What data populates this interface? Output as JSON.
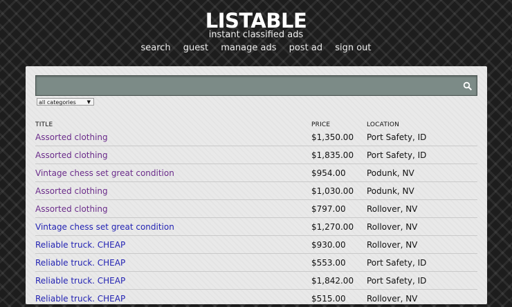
{
  "app": {
    "title": "LISTABLE",
    "tagline": "instant classified ads"
  },
  "nav": [
    {
      "label": "search"
    },
    {
      "label": "guest"
    },
    {
      "label": "manage ads"
    },
    {
      "label": "post ad"
    },
    {
      "label": "sign out"
    }
  ],
  "search": {
    "value": "",
    "category_selected": "all categories"
  },
  "table": {
    "headers": {
      "title": "TITLE",
      "price": "PRICE",
      "location": "LOCATION"
    },
    "rows": [
      {
        "title": "Assorted clothing",
        "price": "$1,350.00",
        "location": "Port Safety, ID",
        "visited": true
      },
      {
        "title": "Assorted clothing",
        "price": "$1,835.00",
        "location": "Port Safety, ID",
        "visited": true
      },
      {
        "title": "Vintage chess set great condition",
        "price": "$954.00",
        "location": "Podunk, NV",
        "visited": true
      },
      {
        "title": "Assorted clothing",
        "price": "$1,030.00",
        "location": "Podunk, NV",
        "visited": true
      },
      {
        "title": "Assorted clothing",
        "price": "$797.00",
        "location": "Rollover, NV",
        "visited": true
      },
      {
        "title": "Vintage chess set great condition",
        "price": "$1,270.00",
        "location": "Rollover, NV",
        "visited": false
      },
      {
        "title": "Reliable truck. CHEAP",
        "price": "$930.00",
        "location": "Rollover, NV",
        "visited": false
      },
      {
        "title": "Reliable truck. CHEAP",
        "price": "$553.00",
        "location": "Port Safety, ID",
        "visited": false
      },
      {
        "title": "Reliable truck. CHEAP",
        "price": "$1,842.00",
        "location": "Port Safety, ID",
        "visited": false
      },
      {
        "title": "Reliable truck. CHEAP",
        "price": "$515.00",
        "location": "Rollover, NV",
        "visited": false
      }
    ]
  },
  "colors": {
    "visited_link": "#6a2b8a",
    "link": "#2323b3",
    "search_bar": "#7c8b87"
  },
  "icons": {
    "search": "search-icon"
  }
}
